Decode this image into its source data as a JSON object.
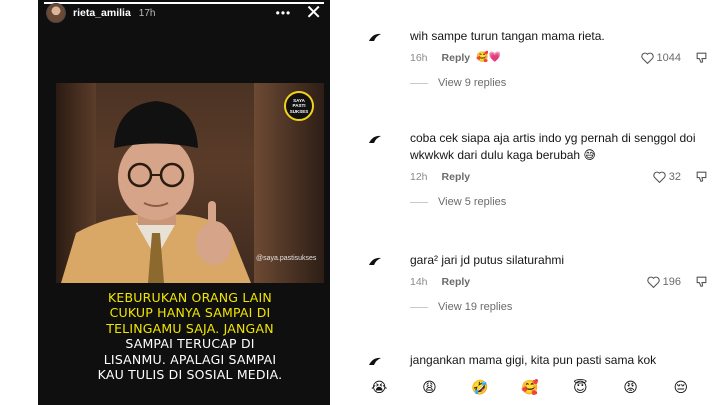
{
  "story": {
    "username": "rieta_amilia",
    "time": "17h",
    "more_label": "•••",
    "close_label": "✕",
    "badge_text": "SAYA PASTI SUKSES",
    "watermark": "@saya.pastisukses",
    "quote_lines": [
      "KEBURUKAN ORANG LAIN",
      "CUKUP HANYA SAMPAI DI",
      "TELINGAMU SAJA. JANGAN",
      "SAMPAI TERUCAP DI",
      "LISANMU. APALAGI SAMPAI",
      "KAU TULIS DI SOSIAL MEDIA."
    ],
    "progress": 1.0
  },
  "comments": [
    {
      "text": "wih sampe turun tangan mama rieta.",
      "time": "16h",
      "reply_label": "Reply",
      "likes": "1044",
      "view_replies": "View 9 replies",
      "reaction_emoji": "🥰💗"
    },
    {
      "text": "coba cek siapa aja artis indo yg pernah di senggol doi wkwkwk dari dulu kaga berubah 😅",
      "time": "12h",
      "reply_label": "Reply",
      "likes": "32",
      "view_replies": "View 5 replies"
    },
    {
      "text": "gara² jari jd putus silaturahmi",
      "time": "14h",
      "reply_label": "Reply",
      "likes": "196",
      "view_replies": "View 19 replies"
    },
    {
      "text": "jangankan mama gigi, kita pun pasti sama kok",
      "time": "",
      "reply_label": "",
      "likes": "",
      "view_replies": ""
    }
  ],
  "emoji_bar": [
    "😭",
    "😩",
    "🤣",
    "🥰",
    "😇",
    "😡",
    "😔"
  ],
  "colors": {
    "quote_yellow": "#f2e600",
    "badge_ring": "#f2d21b",
    "story_bg": "#0f0f0f",
    "muted_text": "#8a8a8a"
  }
}
